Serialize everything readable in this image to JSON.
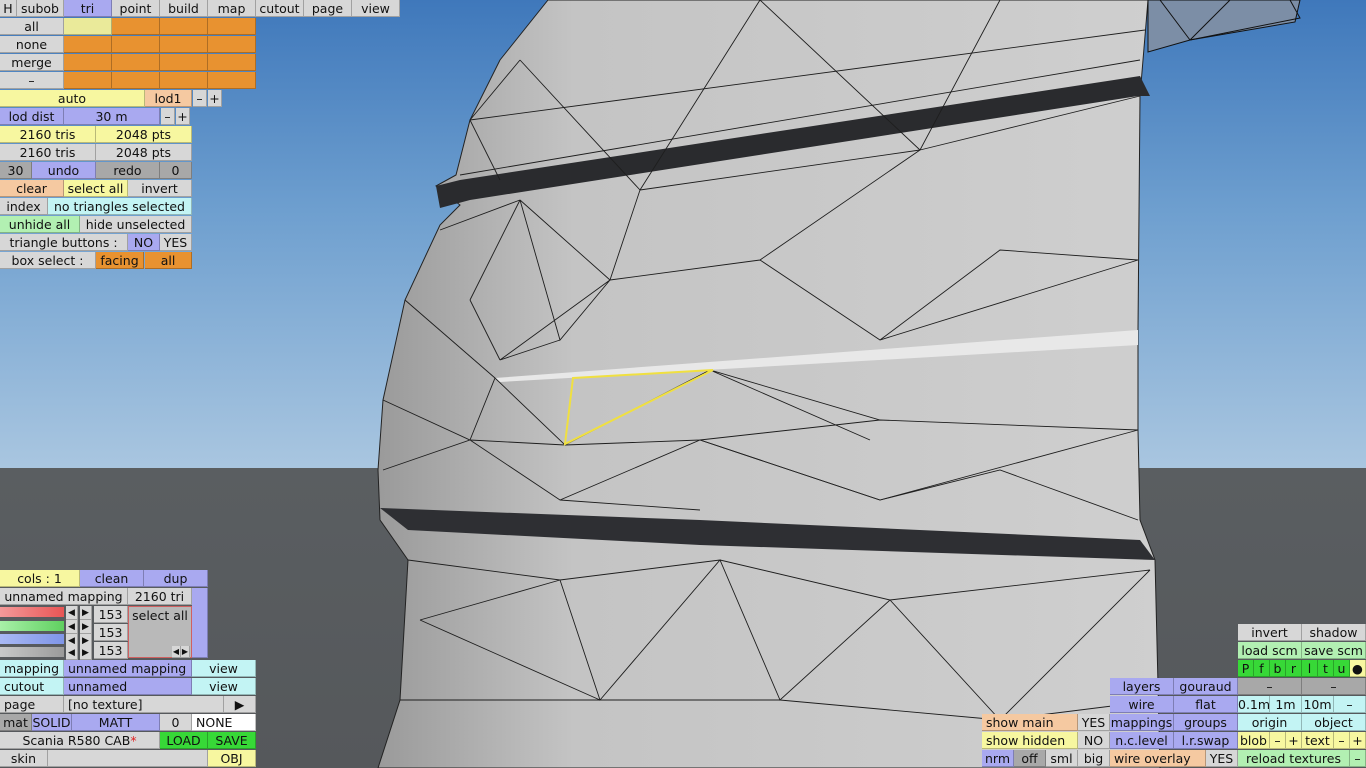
{
  "menu": {
    "items": [
      "H",
      "subob",
      "tri",
      "point",
      "build",
      "map",
      "cutout",
      "page",
      "view"
    ]
  },
  "selection": {
    "all": "all",
    "none": "none",
    "merge": "merge",
    "dash": "–"
  },
  "lod": {
    "mode": "auto",
    "level": "lod1",
    "minus": "–",
    "plus": "+",
    "dist_label": "lod dist",
    "dist_value": "30 m",
    "tris1": "2160 tris",
    "pts1": "2048 pts",
    "tris2": "2160 tris",
    "pts2": "2048 pts"
  },
  "history": {
    "count": "30",
    "undo": "undo",
    "redo": "redo",
    "zero": "0"
  },
  "edit": {
    "clear": "clear",
    "select_all": "select all",
    "invert": "invert",
    "index": "index",
    "status": "no triangles selected",
    "unhide_all": "unhide all",
    "hide_unselected": "hide unselected",
    "triangle_buttons_label": "triangle buttons :",
    "no": "NO",
    "yes": "YES",
    "box_select_label": "box select :",
    "facing": "facing",
    "all": "all"
  },
  "mapping_panel": {
    "cols": "cols : 1",
    "clean": "clean",
    "dup": "dup",
    "name": "unnamed mapping",
    "tri_count": "2160 tri",
    "channels": [
      "153",
      "153",
      "153"
    ],
    "select_all": "select all",
    "mapping_label": "mapping",
    "mapping_value": "unnamed mapping",
    "view1": "view",
    "cutout_label": "cutout",
    "cutout_value": "unnamed",
    "view2": "view",
    "page_label": "page",
    "page_value": "[no texture]",
    "page_arrow": "▶",
    "mat": "mat",
    "solid": "SOLID",
    "matt": "MATT",
    "mat_zero": "0",
    "none": "NONE",
    "object_name": "Scania R580 CAB",
    "asterisk": "*",
    "load": "LOAD",
    "save": "SAVE",
    "skin": "skin",
    "obj": "OBJ"
  },
  "view_panel": {
    "show_main": "show main",
    "show_main_val": "YES",
    "show_hidden": "show hidden",
    "show_hidden_val": "NO",
    "nrm": "nrm",
    "off": "off",
    "sml": "sml",
    "big": "big",
    "layers": "layers",
    "gouraud": "gouraud",
    "wire": "wire",
    "flat": "flat",
    "mappings": "mappings",
    "groups": "groups",
    "nc_level": "n.c.level",
    "lr_swap": "l.r.swap",
    "wire_overlay": "wire overlay",
    "wire_overlay_val": "YES",
    "invert": "invert",
    "shadow": "shadow",
    "load_scm": "load scm",
    "save_scm": "save scm",
    "flags": [
      "P",
      "f",
      "b",
      "r",
      "l",
      "t",
      "u",
      "●"
    ],
    "dash1": "–",
    "dash2": "–",
    "d1": "0.1m",
    "d2": "1m",
    "d3": "10m",
    "d4": "–",
    "origin": "origin",
    "object": "object",
    "blob": "blob",
    "text": "text",
    "pm_minus": "–",
    "pm_plus": "+",
    "reload_textures": "reload textures",
    "reload_minus": "–"
  }
}
